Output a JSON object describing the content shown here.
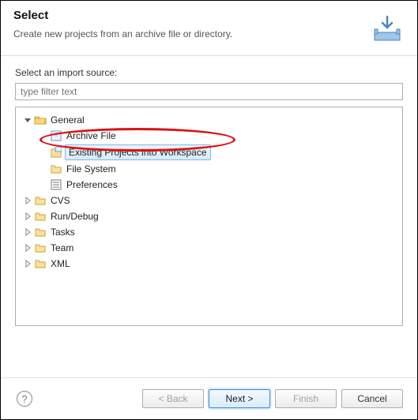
{
  "header": {
    "title": "Select",
    "description": "Create new projects from an archive file or directory."
  },
  "content": {
    "source_label": "Select an import source:",
    "filter_placeholder": "type filter text"
  },
  "tree": {
    "items": [
      {
        "label": "General",
        "expanded": true,
        "icon": "folder-open",
        "children": [
          {
            "label": "Archive File",
            "icon": "archive"
          },
          {
            "label": "Existing Projects into Workspace",
            "icon": "project",
            "selected": true
          },
          {
            "label": "File System",
            "icon": "folder"
          },
          {
            "label": "Preferences",
            "icon": "prefs"
          }
        ]
      },
      {
        "label": "CVS",
        "expanded": false,
        "icon": "folder"
      },
      {
        "label": "Run/Debug",
        "expanded": false,
        "icon": "folder"
      },
      {
        "label": "Tasks",
        "expanded": false,
        "icon": "folder"
      },
      {
        "label": "Team",
        "expanded": false,
        "icon": "folder"
      },
      {
        "label": "XML",
        "expanded": false,
        "icon": "folder"
      }
    ]
  },
  "buttons": {
    "back": "< Back",
    "next": "Next >",
    "finish": "Finish",
    "cancel": "Cancel"
  }
}
